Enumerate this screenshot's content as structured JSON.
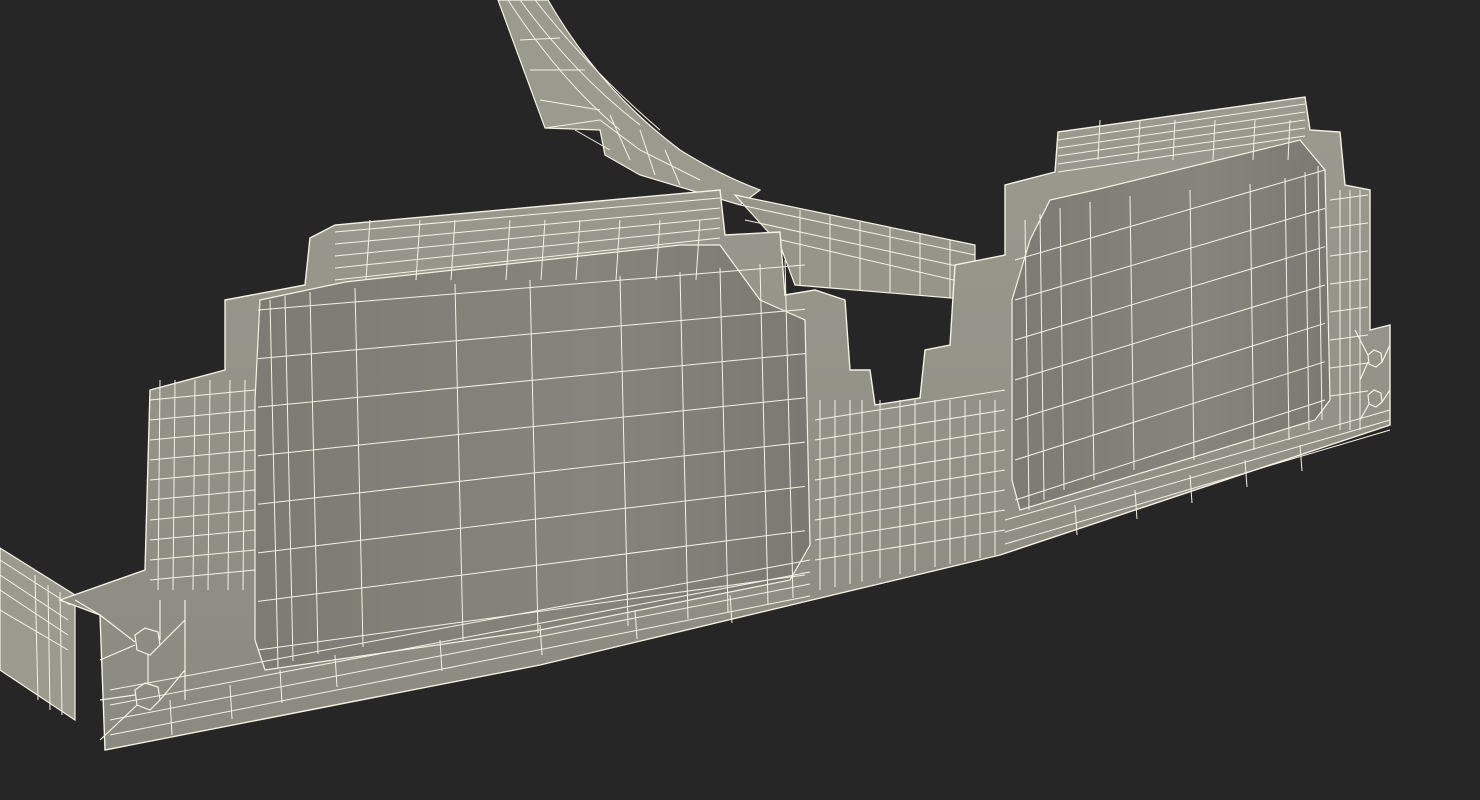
{
  "scene": {
    "background_color": "#262626",
    "object": "wireframe-3d-model",
    "surface_color": "#8e8e84",
    "surface_light_color": "#a2a297",
    "surface_dark_color": "#707069",
    "wire_color": "#f4f2e4"
  }
}
